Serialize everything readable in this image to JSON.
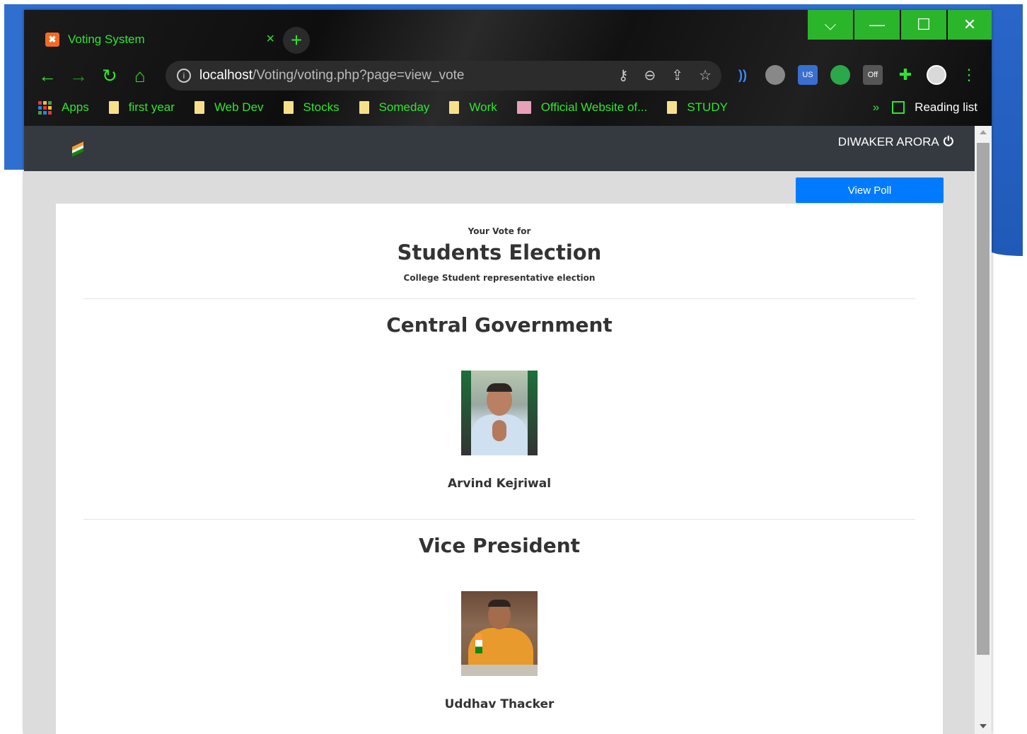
{
  "browser": {
    "tab_title": "Voting System",
    "tab_close": "×",
    "new_tab": "+",
    "url_host": "localhost",
    "url_path": "/Voting/voting.php?page=view_vote",
    "info_glyph": "i",
    "window_controls": {
      "dropdown": "⌵",
      "minimize": "—",
      "maximize": "☐",
      "close": "✕"
    },
    "nav": {
      "back": "←",
      "forward": "→",
      "reload": "↻",
      "home": "⌂"
    },
    "omnibox_icons": {
      "key": "⚷",
      "zoom": "⊖",
      "share": "⇪",
      "star": "☆"
    },
    "extensions": [
      {
        "name": "wifi-ext",
        "label": "))"
      },
      {
        "name": "vpn-ext",
        "label": "US"
      },
      {
        "name": "cookie-ext",
        "label": "Off"
      }
    ],
    "menu_dots": "⋮",
    "overflow": "»",
    "bookmarks": [
      {
        "label": "Apps",
        "type": "apps"
      },
      {
        "label": "first year",
        "type": "folder"
      },
      {
        "label": "Web Dev",
        "type": "folder"
      },
      {
        "label": "Stocks",
        "type": "folder"
      },
      {
        "label": "Someday",
        "type": "folder"
      },
      {
        "label": "Work",
        "type": "folder"
      },
      {
        "label": "Official Website of...",
        "type": "site"
      },
      {
        "label": "STUDY",
        "type": "folder"
      }
    ],
    "reading_list": "Reading list",
    "accent_color": "#2ee52e"
  },
  "navbar": {
    "user_name": "DIWAKER ARORA",
    "power_glyph": "⏻",
    "bg_color": "#343a40"
  },
  "actions": {
    "view_poll": "View Poll",
    "button_color": "#007bff"
  },
  "vote": {
    "pre_title": "Your Vote for",
    "title": "Students Election",
    "description": "College Student representative election",
    "positions": [
      {
        "position": "Central Government",
        "candidate": "Arvind Kejriwal"
      },
      {
        "position": "Vice President",
        "candidate": "Uddhav Thacker"
      }
    ]
  }
}
